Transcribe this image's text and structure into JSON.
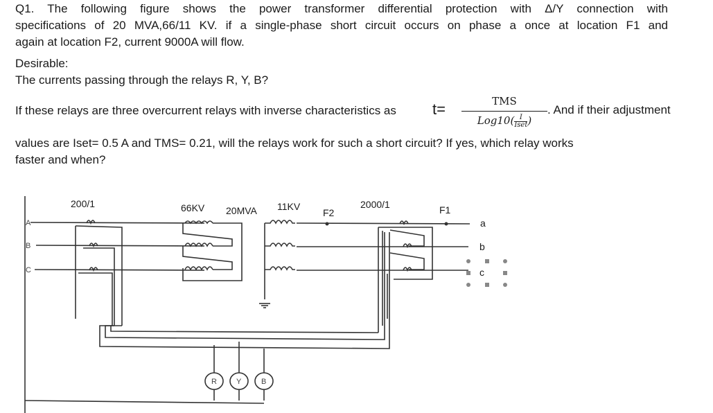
{
  "question": {
    "line1": "Q1. The following figure shows the power transformer differential protection with Δ/Y connection with",
    "line2": "specifications of 20 MVA,66/11 KV. if a single-phase short circuit occurs on phase a once at location F1 and",
    "line3": "again at location F2, current 9000A will flow.",
    "desirable_label": "Desirable:",
    "relay_question": "The currents passing through the relays R, Y, B?",
    "condition_prefix": "If these relays are three overcurrent relays with inverse characteristics as",
    "formula": {
      "lhs": "t=",
      "numerator": "TMS",
      "denominator_prefix": "Log10(",
      "inner_numerator": "I",
      "inner_denominator": "Iset",
      "denominator_suffix": ")"
    },
    "condition_suffix": ". And if their adjustment",
    "values_line": "values are Iset= 0.5 A and TMS= 0.21, will the relays work for such a short circuit? If yes, which relay works",
    "faster_line": "faster and when?"
  },
  "diagram": {
    "ct_primary_ratio": "200/1",
    "hv_voltage": "66KV",
    "rating": "20MVA",
    "lv_voltage": "11KV",
    "fault_f2": "F2",
    "ct_secondary_ratio": "2000/1",
    "fault_f1": "F1",
    "hv_phases": [
      "A",
      "B",
      "C"
    ],
    "lv_phases": [
      "a",
      "b",
      "c"
    ],
    "relays": [
      "R",
      "Y",
      "B"
    ]
  }
}
